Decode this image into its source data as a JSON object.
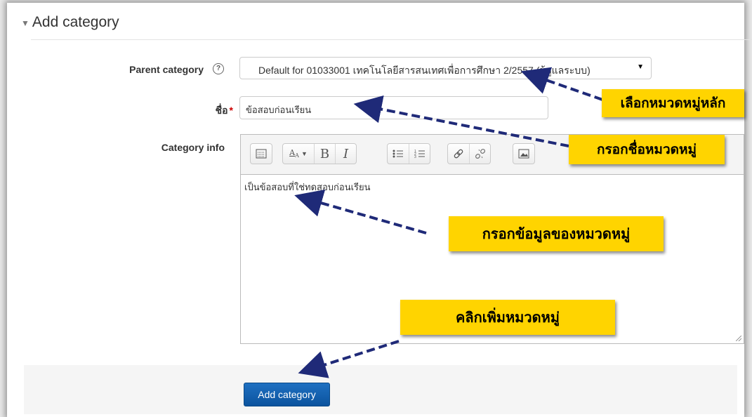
{
  "form": {
    "legend": "Add category",
    "parent_label": "Parent category",
    "parent_value": "Default for 01033001 เทคโนโลยีสารสนเทศเพื่อการศึกษา 2/2557 (ผู้ดูแลระบบ)",
    "name_label": "ชื่อ",
    "name_required_mark": "*",
    "name_value": "ข้อสอบก่อนเรียน",
    "info_label": "Category info",
    "info_value": "เป็นข้อสอบที่ใช่ทดสอบก่อนเรียน",
    "submit_label": "Add category"
  },
  "toolbar": {
    "groups": [
      [
        "show-more-icon"
      ],
      [
        "font-style-icon",
        "bold-icon",
        "italic-icon"
      ],
      [
        "unordered-list-icon",
        "ordered-list-icon"
      ],
      [
        "link-icon",
        "unlink-icon"
      ],
      [
        "image-icon"
      ]
    ],
    "bold_glyph": "B",
    "italic_glyph": "I"
  },
  "callouts": {
    "select_parent": "เลือกหมวดหมู่หลัก",
    "enter_name": "กรอกชื่อหมวดหมู่",
    "enter_info": "กรอกข้อมูลของหมวดหมู่",
    "click_add": "คลิกเพิ่มหมวดหมู่"
  },
  "colors": {
    "callout_bg": "#ffd400",
    "arrow": "#1f2a78",
    "button": "#0f5da8",
    "required": "#cc0000"
  }
}
